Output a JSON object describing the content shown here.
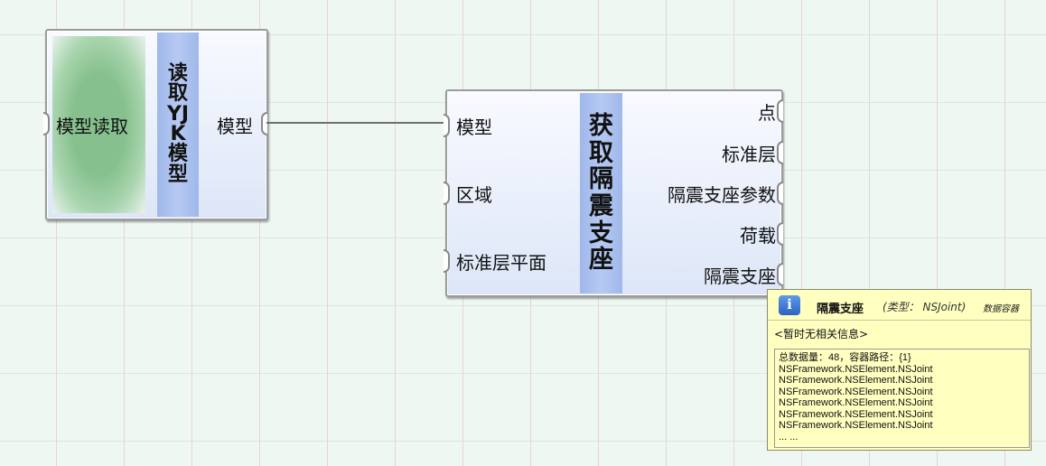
{
  "node1": {
    "input_label": "模型读取",
    "title": "读取YJK模型",
    "output_label": "模型"
  },
  "node2": {
    "title": "获取隔震支座",
    "inputs": [
      "模型",
      "区域",
      "标准层平面"
    ],
    "outputs": [
      "点",
      "标准层",
      "隔震支座参数",
      "荷载",
      "隔震支座"
    ]
  },
  "tooltip": {
    "icon": "info-icon",
    "title": "隔震支座",
    "type": "(类型： NSJoint)",
    "container": "数据容器",
    "no_info": "<暂时无相关信息>",
    "summary": "总数据量：48，容器路径：{1}",
    "items": [
      "NSFramework.NSElement.NSJoint",
      "NSFramework.NSElement.NSJoint",
      "NSFramework.NSElement.NSJoint",
      "NSFramework.NSElement.NSJoint",
      "NSFramework.NSElement.NSJoint",
      "NSFramework.NSElement.NSJoint"
    ],
    "more": "... ..."
  },
  "colors": {
    "grid_background": "#eef7f2",
    "node_title_strip": "#a9c0ef",
    "tooltip_background": "#ffffc0",
    "wire": "#6f6f6f"
  }
}
